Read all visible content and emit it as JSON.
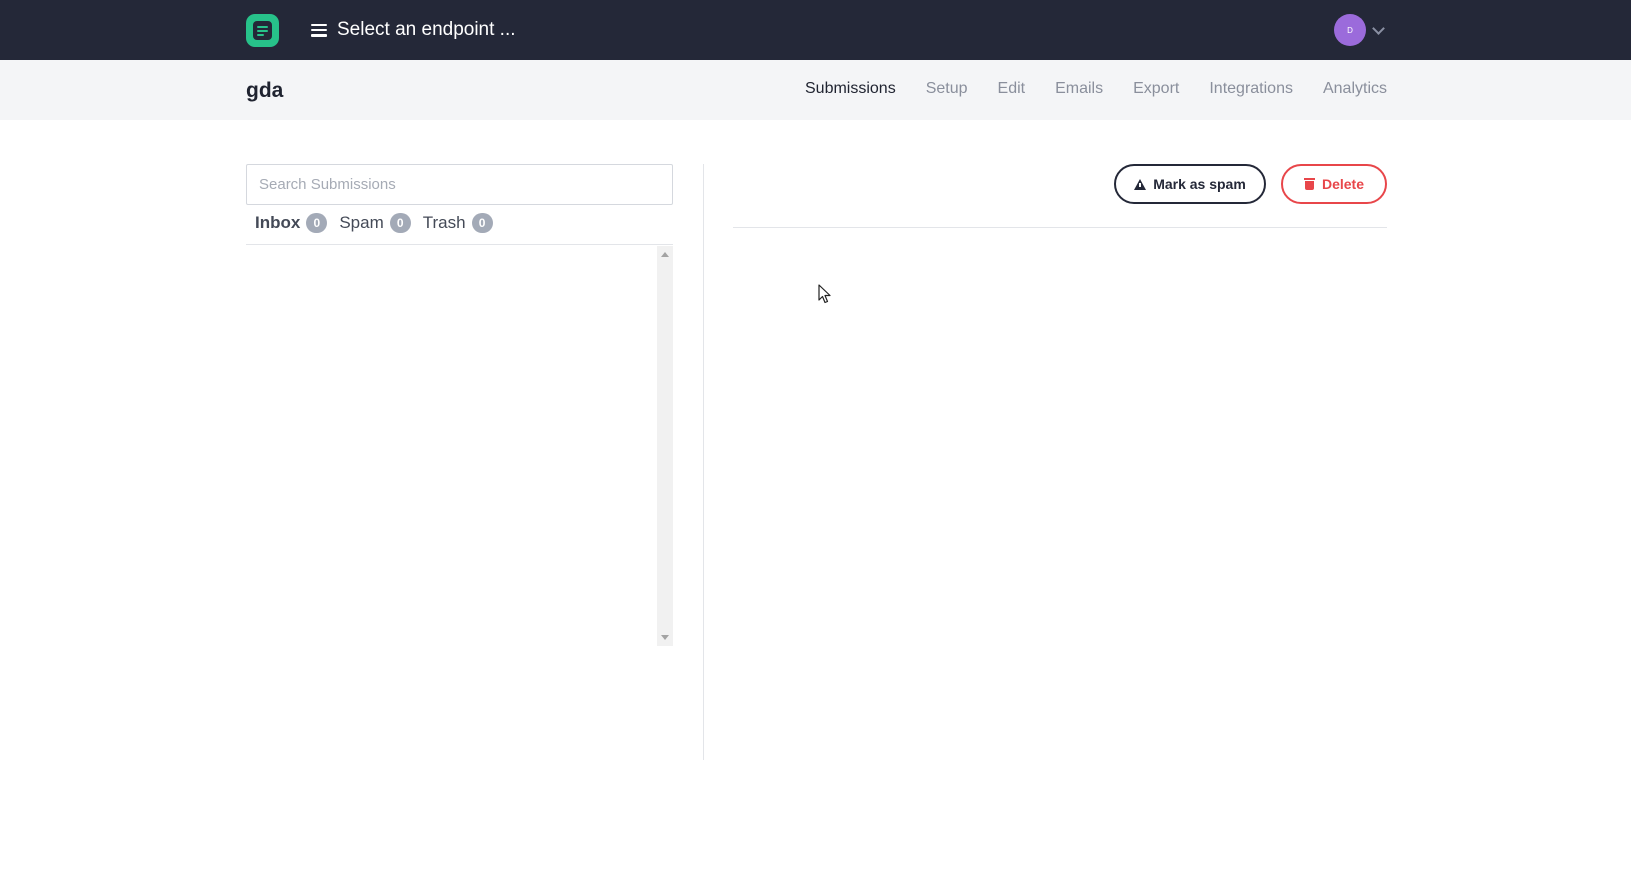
{
  "header": {
    "endpoint_selector_label": "Select an endpoint ...",
    "user_initial": "D",
    "icons": {
      "logo": "app-logo-icon",
      "menu": "hamburger-menu-icon",
      "dropdown": "chevron-down-icon"
    }
  },
  "form": {
    "title": "gda",
    "tabs": [
      {
        "label": "Submissions",
        "active": true
      },
      {
        "label": "Setup",
        "active": false
      },
      {
        "label": "Edit",
        "active": false
      },
      {
        "label": "Emails",
        "active": false
      },
      {
        "label": "Export",
        "active": false
      },
      {
        "label": "Integrations",
        "active": false
      },
      {
        "label": "Analytics",
        "active": false
      }
    ]
  },
  "submissions": {
    "search_placeholder": "Search Submissions",
    "folders": [
      {
        "label": "Inbox",
        "count": "0",
        "active": true
      },
      {
        "label": "Spam",
        "count": "0",
        "active": false
      },
      {
        "label": "Trash",
        "count": "0",
        "active": false
      }
    ]
  },
  "actions": {
    "mark_spam_label": "Mark as spam",
    "delete_label": "Delete"
  },
  "colors": {
    "topbar": "#242838",
    "brand": "#27c28a",
    "avatar": "#9b6bdb",
    "danger": "#e8464a",
    "subheader": "#f4f5f7"
  }
}
